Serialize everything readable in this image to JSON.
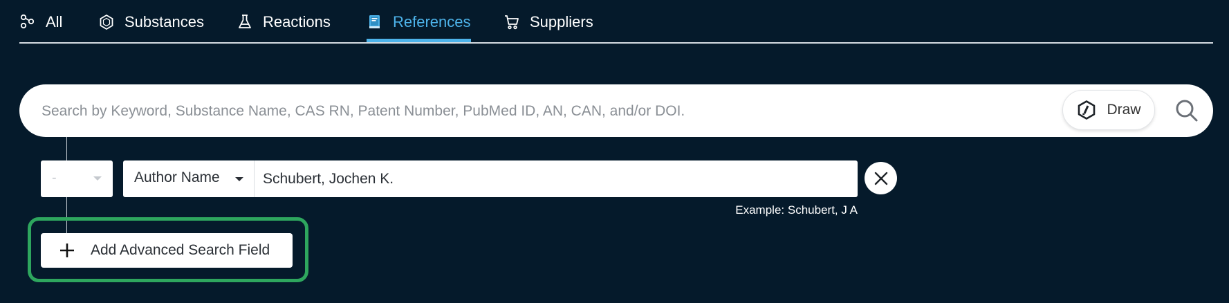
{
  "tabs": [
    {
      "label": "All",
      "icon": "molecule-icon",
      "active": false
    },
    {
      "label": "Substances",
      "icon": "hexagon-icon",
      "active": false
    },
    {
      "label": "Reactions",
      "icon": "flask-icon",
      "active": false
    },
    {
      "label": "References",
      "icon": "book-icon",
      "active": true
    },
    {
      "label": "Suppliers",
      "icon": "cart-icon",
      "active": false
    }
  ],
  "search": {
    "placeholder": "Search by Keyword, Substance Name, CAS RN, Patent Number, PubMed ID, AN, CAN, and/or DOI.",
    "value": "",
    "draw_label": "Draw"
  },
  "advanced": {
    "operator": "-",
    "field": "Author Name",
    "value": "Schubert, Jochen K.",
    "example_label": "Example:",
    "example_value": "Schubert, J A",
    "add_label": "Add Advanced Search Field"
  },
  "colors": {
    "background": "#051a2b",
    "accent": "#4db3ea",
    "highlight": "#2ea65e"
  }
}
